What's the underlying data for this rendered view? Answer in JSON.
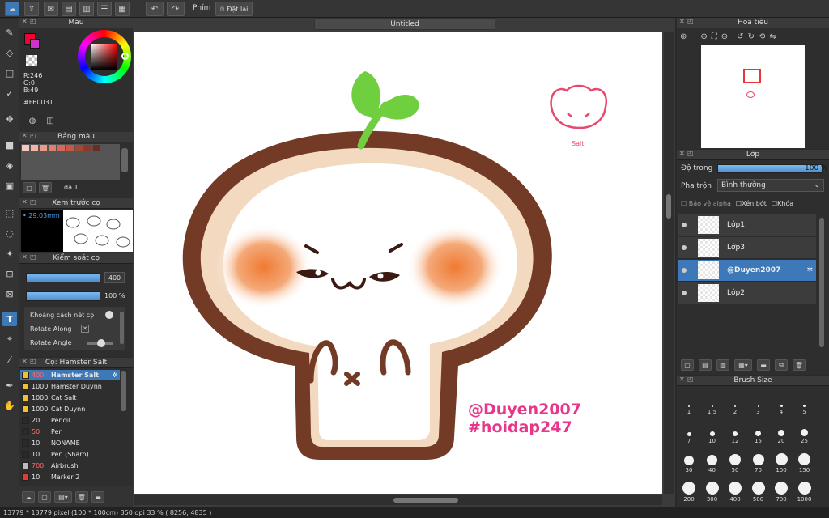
{
  "app": {
    "doc_title": "Untitled"
  },
  "toolbar": {
    "brush_label": "Phím",
    "reset_label": "Đặt lại"
  },
  "color_panel": {
    "title": "Màu",
    "r": "R:246",
    "g": "G:0",
    "b": "B:49",
    "hex": "#F60031",
    "main_color": "#f60031",
    "sub_color": "#cc33cc"
  },
  "palette_panel": {
    "title": "Bảng màu",
    "set_label": "da 1"
  },
  "brush_preview": {
    "title": "Xem trước cọ",
    "size": "• 29.03mm"
  },
  "brush_control": {
    "title": "Kiểm soát cọ",
    "size_value": "400",
    "opacity_value": "100 %",
    "spacing_label": "Khoảng cách nét cọ",
    "rotate_along_label": "Rotate Along",
    "rotate_angle_label": "Rotate Angle"
  },
  "brush_list": {
    "title": "Cọ: Hamster Salt",
    "items": [
      {
        "size": "400",
        "name": "Hamster Salt",
        "swatch": "#f2c12e",
        "selected": true,
        "size_red": true
      },
      {
        "size": "1000",
        "name": "Hamster Duynn",
        "swatch": "#f2c12e"
      },
      {
        "size": "1000",
        "name": "Cat Salt",
        "swatch": "#f2c12e"
      },
      {
        "size": "1000",
        "name": "Cat Duynn",
        "swatch": "#f2c12e"
      },
      {
        "size": "20",
        "name": "Pencil",
        "swatch": "#2a2a2a"
      },
      {
        "size": "50",
        "name": "Pen",
        "swatch": "#2a2a2a",
        "size_red": true
      },
      {
        "size": "10",
        "name": "NONAME",
        "swatch": "#2a2a2a"
      },
      {
        "size": "10",
        "name": "Pen (Sharp)",
        "swatch": "#2a2a2a"
      },
      {
        "size": "700",
        "name": "Airbrush",
        "swatch": "#bbbbbb",
        "size_red": true
      },
      {
        "size": "10",
        "name": "Marker 2",
        "swatch": "#e53935"
      }
    ]
  },
  "canvas": {
    "watermark_line1": "@Duyen2007",
    "watermark_line2": "#hoidap247",
    "logo_text": "Salt"
  },
  "navigator": {
    "title": "Hoa tiêu"
  },
  "layers": {
    "title": "Lớp",
    "opacity_label": "Độ trong",
    "opacity_value": "100 %",
    "blend_label": "Pha trộn",
    "blend_value": "Bình thường",
    "protect_alpha": "Bảo vệ alpha",
    "clipping": "Xén bớt",
    "lock": "Khóa",
    "items": [
      {
        "name": "Lớp1",
        "selected": false
      },
      {
        "name": "Lớp3",
        "selected": false
      },
      {
        "name": "@Duyen2007",
        "selected": true
      },
      {
        "name": "Lớp2",
        "selected": false
      }
    ]
  },
  "brush_size": {
    "title": "Brush Size",
    "sizes": [
      "1",
      "1.5",
      "2",
      "3",
      "4",
      "5",
      "7",
      "10",
      "12",
      "15",
      "20",
      "25",
      "30",
      "40",
      "50",
      "70",
      "100",
      "150",
      "200",
      "300",
      "400",
      "500",
      "700",
      "1000"
    ]
  },
  "status": {
    "text": "13779 * 13779 pixel  (100 * 100cm)  350 dpi  33 %  ( 8256, 4835 )"
  }
}
